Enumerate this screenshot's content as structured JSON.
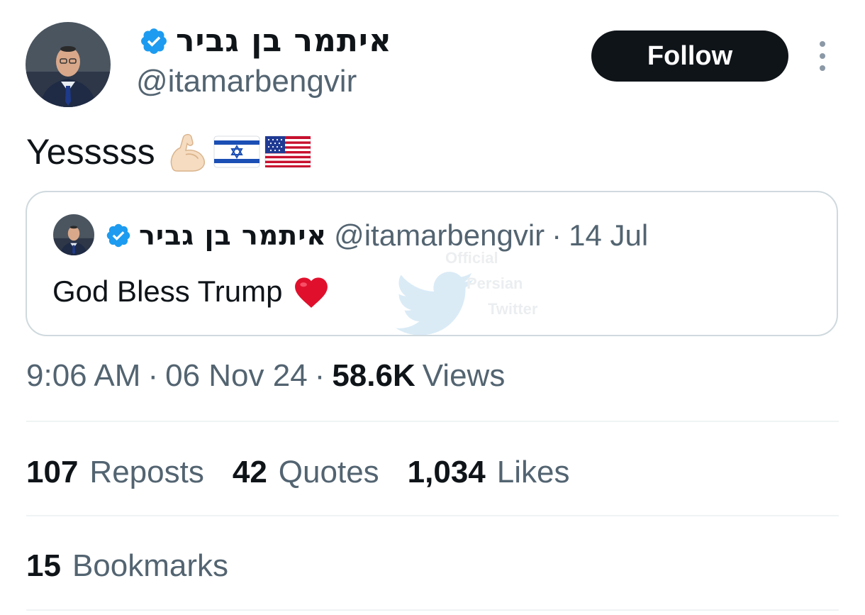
{
  "tweet": {
    "author": {
      "display_name": "איתמר בן גביר",
      "handle": "@itamarbengvir",
      "verified": true
    },
    "follow_label": "Follow",
    "text": "Yesssss",
    "emojis": [
      "flexed-biceps",
      "flag-israel",
      "flag-united-states"
    ],
    "quote": {
      "display_name": "איתמר בן גביר",
      "handle": "@itamarbengvir",
      "separator": "·",
      "date": "14 Jul",
      "text": "God Bless Trump",
      "emoji": "red-heart"
    },
    "watermark": {
      "line1": "Official",
      "line2": "Persian",
      "line3": "Twitter"
    },
    "meta": {
      "time": "9:06 AM",
      "separator": "·",
      "date": "06 Nov 24",
      "views_count": "58.6K",
      "views_label": "Views"
    },
    "stats": [
      {
        "count": "107",
        "label": "Reposts"
      },
      {
        "count": "42",
        "label": "Quotes"
      },
      {
        "count": "1,034",
        "label": "Likes"
      }
    ],
    "bookmarks": {
      "count": "15",
      "label": "Bookmarks"
    }
  },
  "colors": {
    "text_primary": "#0f1419",
    "text_secondary": "#536471",
    "verified_blue": "#1d9bf0",
    "border": "#cfd9de",
    "divider": "#eff3f4",
    "follow_bg": "#0f1419"
  }
}
